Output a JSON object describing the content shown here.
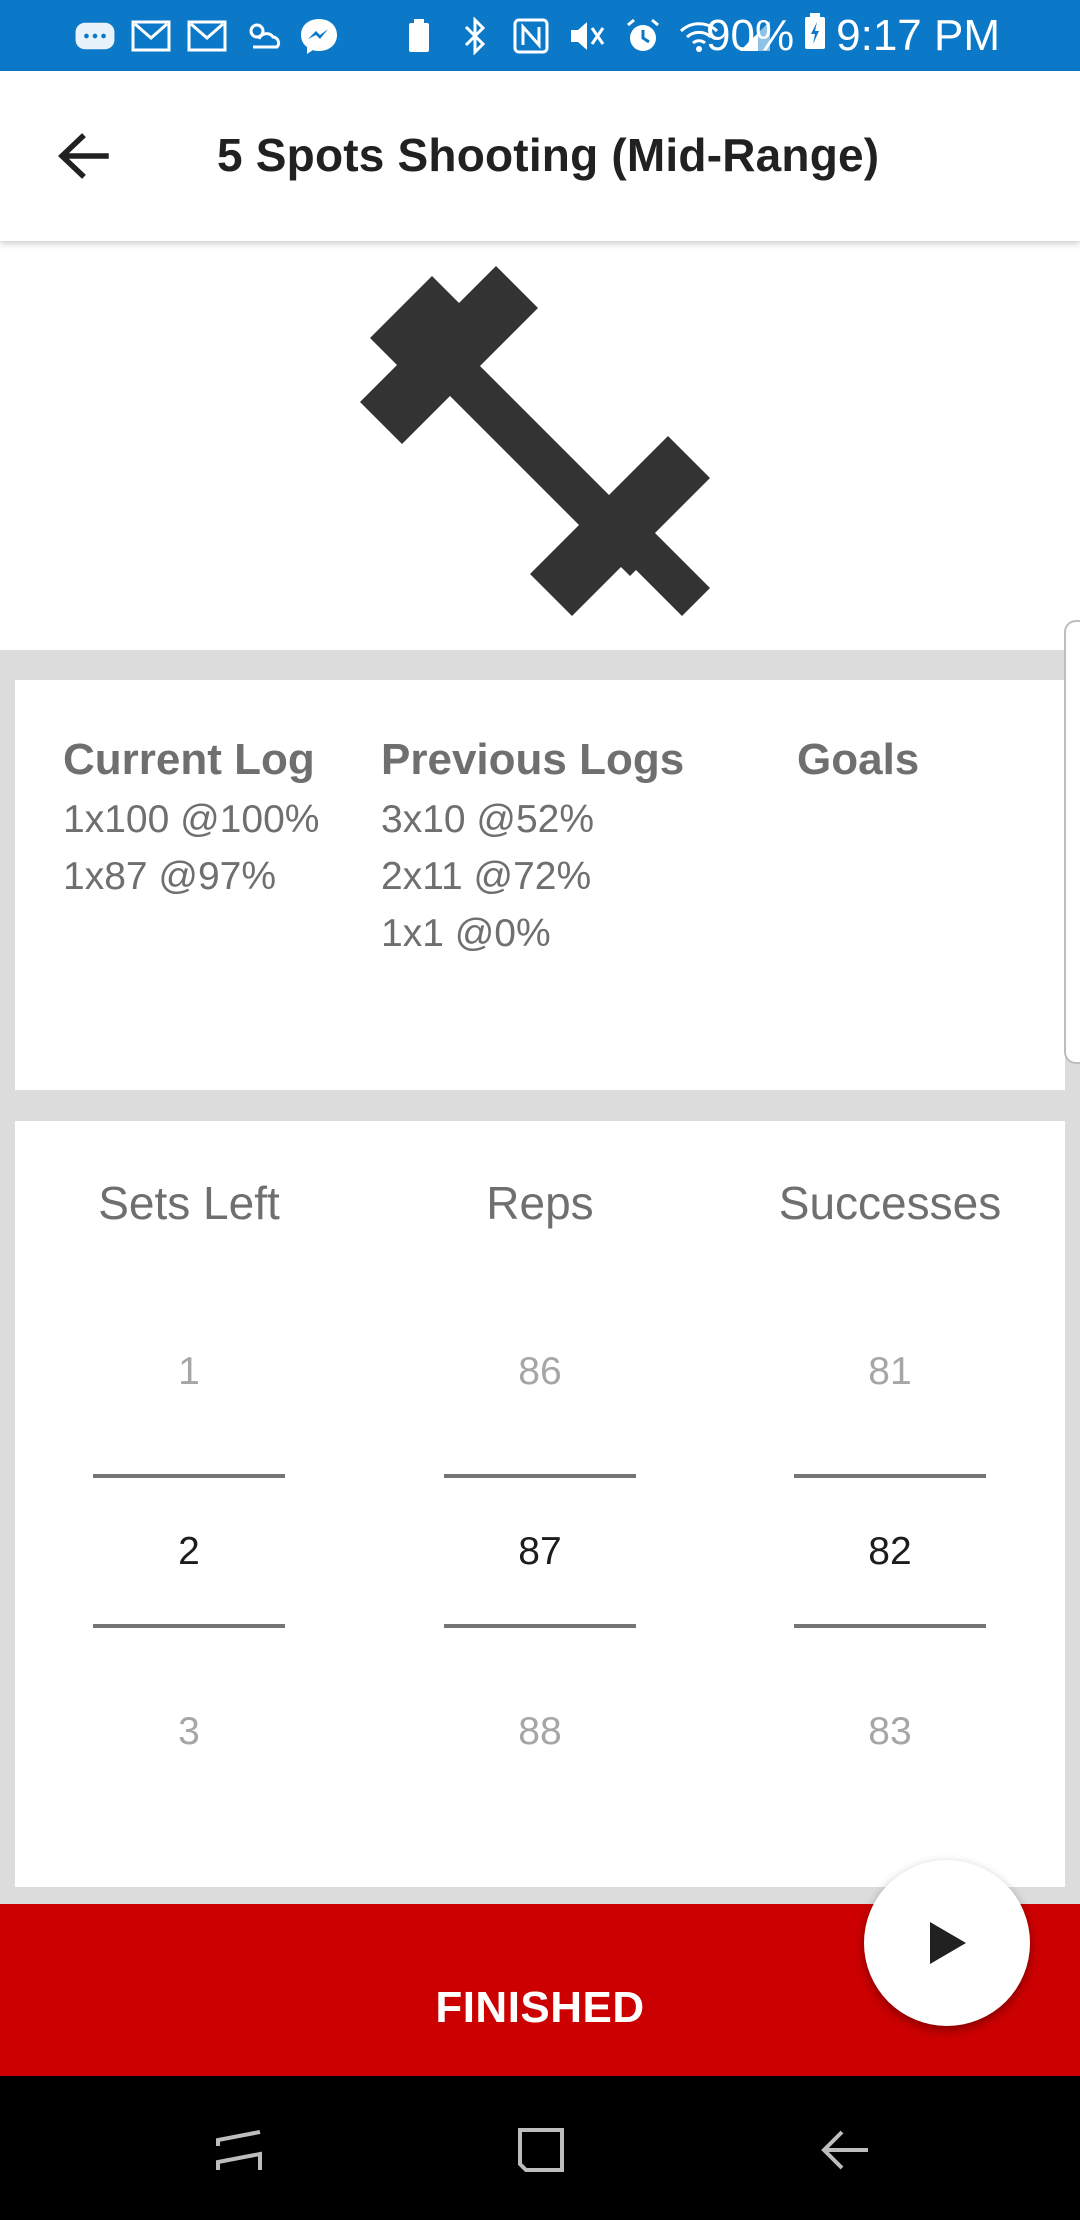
{
  "status_bar": {
    "battery": "90%",
    "time": "9:17 PM",
    "icons": [
      "messages-icon",
      "gmail-icon",
      "gmail-icon",
      "weather-icon",
      "messenger-icon",
      "battery-saver-icon",
      "bluetooth-icon",
      "nfc-icon",
      "mute-icon",
      "alarm-icon",
      "wifi-icon",
      "signal-icon",
      "battery-charging-icon"
    ]
  },
  "app_bar": {
    "title": "5 Spots Shooting (Mid-Range)",
    "back_icon": "arrow-back-icon"
  },
  "hero": {
    "icon": "dumbbell-icon"
  },
  "logs": {
    "current": {
      "heading": "Current Log",
      "entries": [
        "1x100 @100%",
        "1x87 @97%"
      ]
    },
    "previous": {
      "heading": "Previous Logs",
      "entries": [
        "3x10 @52%",
        "2x11 @72%",
        "1x1 @0%"
      ]
    },
    "goals": {
      "heading": "Goals",
      "entries": []
    }
  },
  "pickers": [
    {
      "label": "Sets Left",
      "prev": "1",
      "current": "2",
      "next": "3"
    },
    {
      "label": "Reps",
      "prev": "86",
      "current": "87",
      "next": "88"
    },
    {
      "label": "Successes",
      "prev": "81",
      "current": "82",
      "next": "83"
    }
  ],
  "finished_label": "FINISHED",
  "fab_icon": "play-icon",
  "colors": {
    "status_bar": "#0b79c7",
    "accent_red": "#cc0000",
    "dark_icon": "#333333"
  },
  "nav_bar": [
    "recents-icon",
    "home-icon",
    "back-icon"
  ]
}
